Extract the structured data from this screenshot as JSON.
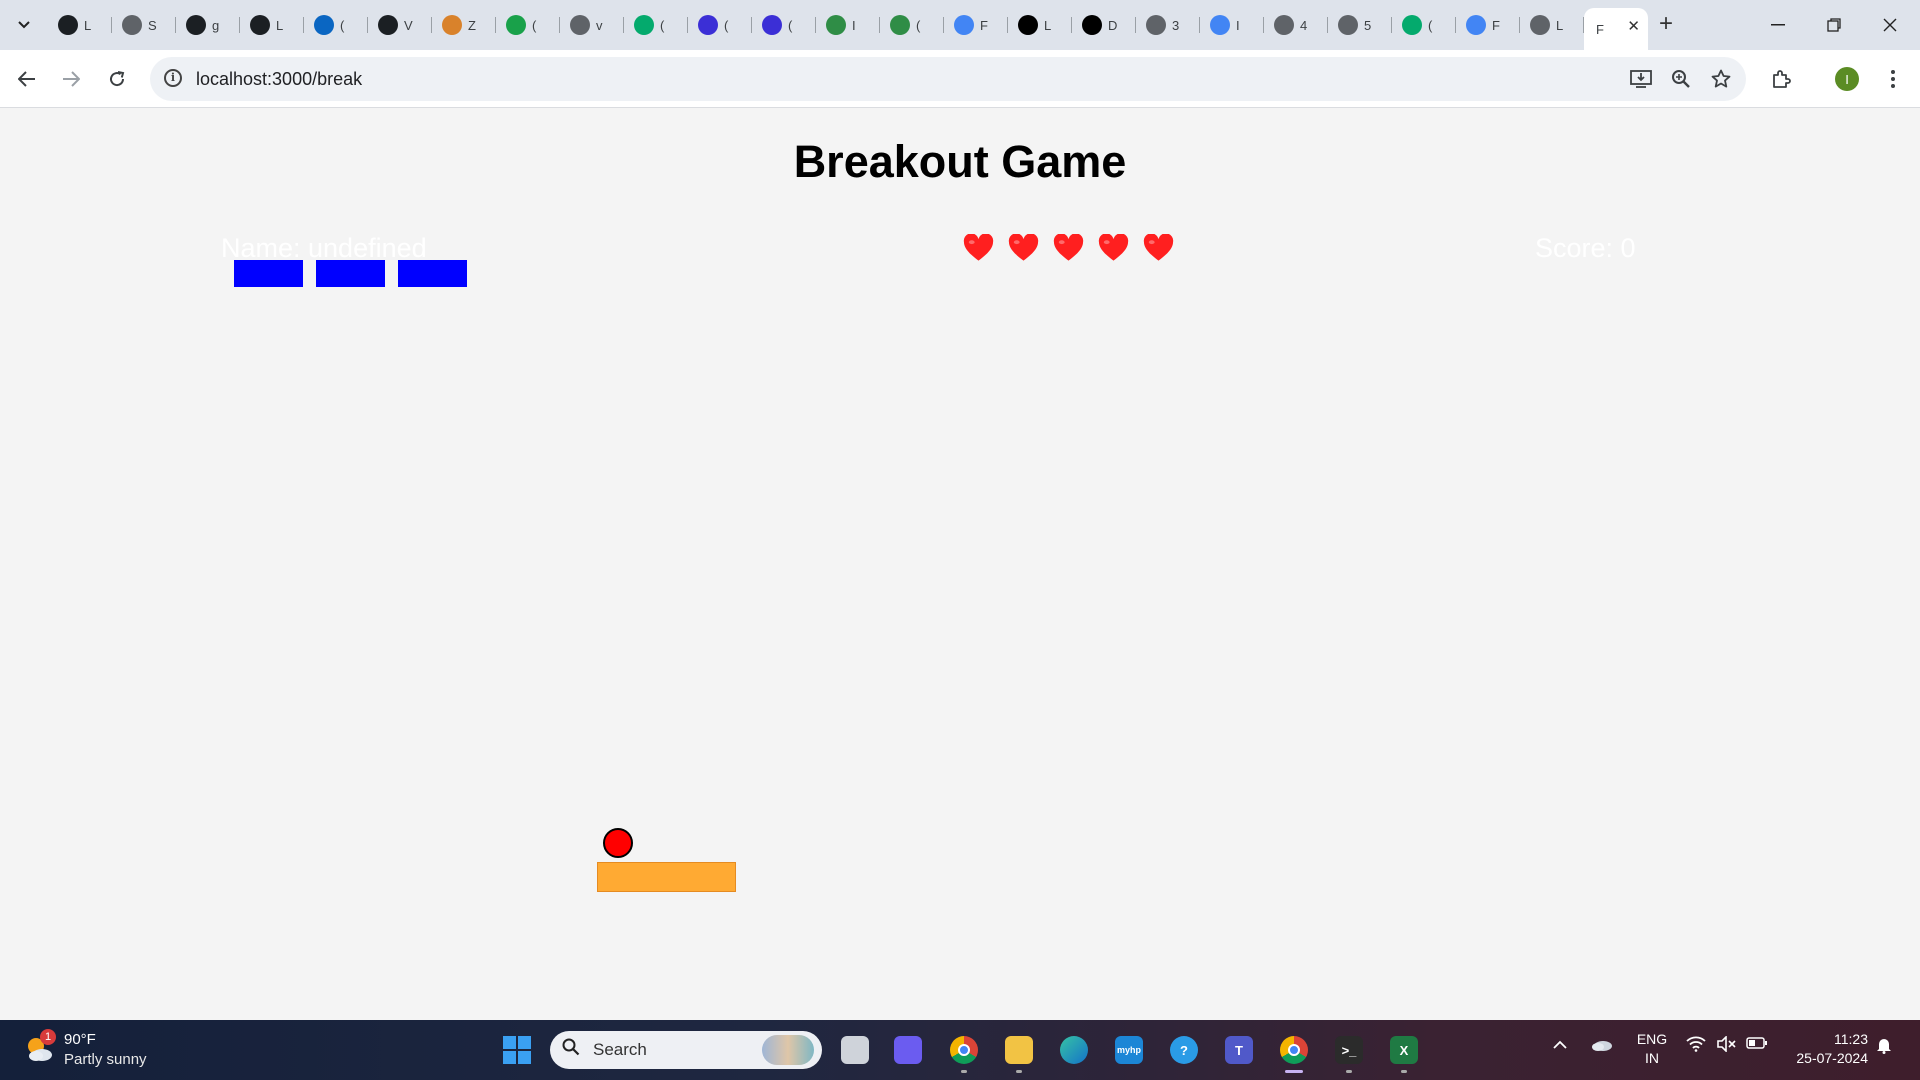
{
  "browser": {
    "tabs": [
      {
        "icon": "github-icon",
        "label": "L",
        "color": "#1b1f23"
      },
      {
        "icon": "globe-icon",
        "label": "S",
        "color": "#5f6368"
      },
      {
        "icon": "github-icon",
        "label": "g",
        "color": "#1b1f23"
      },
      {
        "icon": "github-icon",
        "label": "L",
        "color": "#1b1f23"
      },
      {
        "icon": "linkedin-icon",
        "label": "(",
        "color": "#0a66c2"
      },
      {
        "icon": "github-icon",
        "label": "V",
        "color": "#1b1f23"
      },
      {
        "icon": "pen-icon",
        "label": "Z",
        "color": "#d9822b"
      },
      {
        "icon": "green-f-icon",
        "label": "(",
        "color": "#19a14a"
      },
      {
        "icon": "globe-icon",
        "label": "v",
        "color": "#5f6368"
      },
      {
        "icon": "w3-icon",
        "label": "(",
        "color": "#04aa6d"
      },
      {
        "icon": "p-icon",
        "label": "(",
        "color": "#3b2fd6"
      },
      {
        "icon": "p-icon",
        "label": "(",
        "color": "#3b2fd6"
      },
      {
        "icon": "gfg-icon",
        "label": "I",
        "color": "#2f8d46"
      },
      {
        "icon": "gfg-icon",
        "label": "(",
        "color": "#2f8d46"
      },
      {
        "icon": "google-icon",
        "label": "F",
        "color": "#4285f4"
      },
      {
        "icon": "hn-icon",
        "label": "L",
        "color": "#000000"
      },
      {
        "icon": "hn-icon",
        "label": "D",
        "color": "#000000"
      },
      {
        "icon": "wordpress-icon",
        "label": "3",
        "color": "#5f6368"
      },
      {
        "icon": "google-icon",
        "label": "I",
        "color": "#4285f4"
      },
      {
        "icon": "wordpress-icon",
        "label": "4",
        "color": "#5f6368"
      },
      {
        "icon": "wordpress-icon",
        "label": "5",
        "color": "#5f6368"
      },
      {
        "icon": "w3-icon",
        "label": "(",
        "color": "#04aa6d"
      },
      {
        "icon": "google-icon",
        "label": "F",
        "color": "#4285f4"
      },
      {
        "icon": "globe-icon",
        "label": "L",
        "color": "#5f6368"
      }
    ],
    "active_tab": {
      "label": "F",
      "close": "✕"
    },
    "new_tab": "+",
    "window_controls": {
      "minimize": "—",
      "restore": "❐",
      "close": "✕"
    },
    "url": "localhost:3000/break",
    "profile_initial": "I"
  },
  "game": {
    "title": "Breakout Game",
    "player_label": "Name: undefined",
    "score_label": "Score: 0",
    "lives": 5,
    "heart_color": "#ff1f1f",
    "brick_color": "#0000ff",
    "bricks_remaining": 3,
    "ball_color": "#ff0000",
    "paddle_color": "#ffaa33"
  },
  "taskbar": {
    "weather": {
      "temp": "90°F",
      "desc": "Partly sunny",
      "badge": "1"
    },
    "search_placeholder": "Search",
    "apps": [
      {
        "name": "task-view",
        "color": "#cfd3da",
        "glyph": ""
      },
      {
        "name": "copilot",
        "color": "#6b5cf0",
        "glyph": ""
      },
      {
        "name": "chrome",
        "color": "#e6b027",
        "glyph": ""
      },
      {
        "name": "file-explorer",
        "color": "#f2c344",
        "glyph": ""
      },
      {
        "name": "edge",
        "color": "#1493c9",
        "glyph": ""
      },
      {
        "name": "myhp",
        "color": "#1c86d6",
        "glyph": "myhp"
      },
      {
        "name": "help",
        "color": "#2a9be6",
        "glyph": "?"
      },
      {
        "name": "teams",
        "color": "#5059c9",
        "glyph": "T"
      },
      {
        "name": "chrome-active",
        "color": "#e6b027",
        "glyph": ""
      },
      {
        "name": "terminal",
        "color": "#2b2b2b",
        "glyph": ">_"
      },
      {
        "name": "excel",
        "color": "#1f7a43",
        "glyph": "X"
      }
    ],
    "language": {
      "line1": "ENG",
      "line2": "IN"
    },
    "time": "11:23",
    "date": "25-07-2024"
  }
}
